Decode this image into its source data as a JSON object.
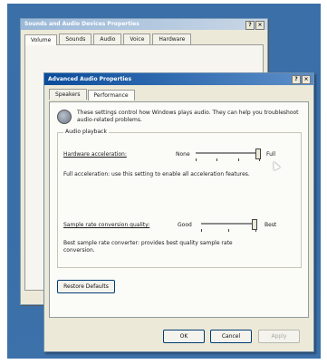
{
  "back_window": {
    "title": "Sounds and Audio Devices Properties",
    "title_btn_help": "?",
    "title_btn_close": "×",
    "tabs": [
      "Volume",
      "Sounds",
      "Audio",
      "Voice",
      "Hardware"
    ]
  },
  "dialog": {
    "title": "Advanced Audio Properties",
    "title_btn_help": "?",
    "title_btn_close": "×",
    "tabs": [
      "Speakers",
      "Performance"
    ],
    "info_text": "These settings control how Windows plays audio. They can help you troubleshoot audio-related problems.",
    "group_label": "Audio playback",
    "hw_accel": {
      "label": "Hardware acceleration:",
      "min_label": "None",
      "max_label": "Full",
      "level": 1.0,
      "description": "Full acceleration: use this setting to enable all acceleration features."
    },
    "src_quality": {
      "label": "Sample rate conversion quality:",
      "min_label": "Good",
      "max_label": "Best",
      "level": 1.0,
      "description": "Best sample rate converter: provides best quality sample rate conversion."
    },
    "restore_button": "Restore Defaults",
    "ok_button": "OK",
    "cancel_button": "Cancel",
    "apply_button": "Apply"
  },
  "icons": {
    "speaker": "speaker-icon",
    "cursor": "mouse-pointer-icon"
  },
  "colors": {
    "desktop": "#3b6fa8",
    "title_active": "#0a4c9a",
    "dialog_bg": "#ece9d8"
  }
}
